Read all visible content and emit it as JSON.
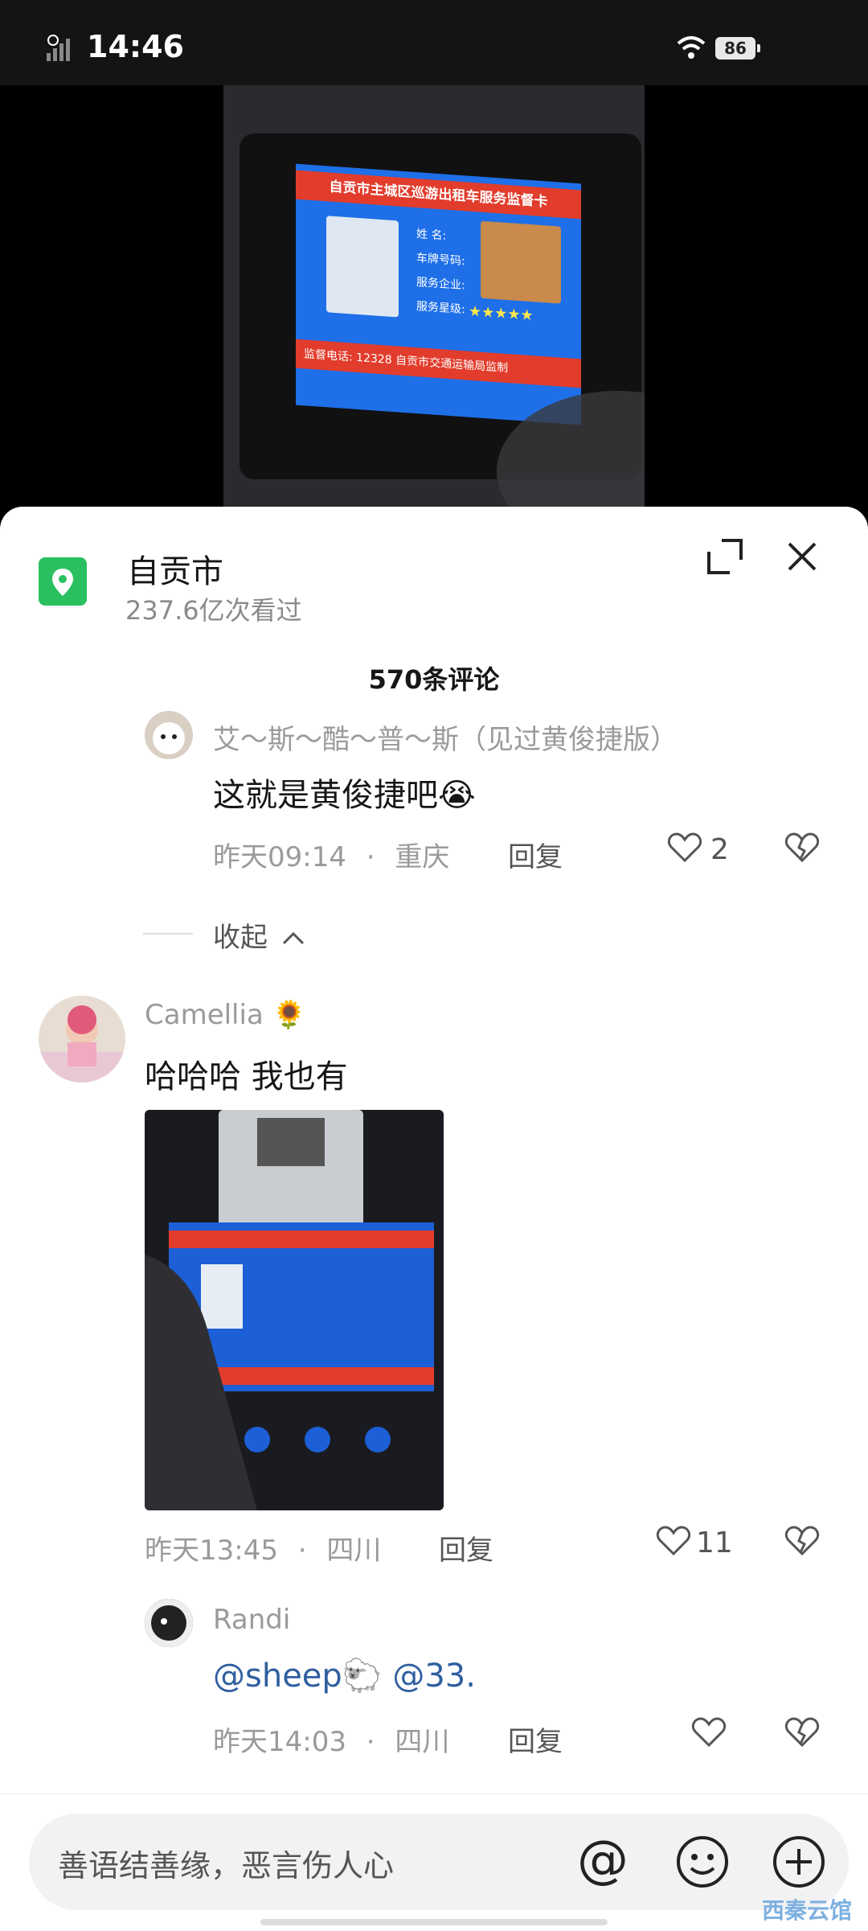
{
  "status_bar": {
    "time": "14:46",
    "battery": "86"
  },
  "video": {
    "screen_title": "自贡市主城区巡游出租车服务监督卡",
    "screen_fields": [
      "姓 名:",
      "车牌号码:",
      "服务企业:",
      "服务星级:"
    ],
    "screen_stars": "★★★★★",
    "screen_bottom": "监督电话: 12328   自贡市交通运输局监制"
  },
  "location": {
    "title": "自贡市",
    "views": "237.6亿次看过"
  },
  "comments_count": "570条评论",
  "comments": [
    {
      "name": "艾～斯～酷～普～斯（见过黄俊捷版）",
      "text": "这就是黄俊捷吧😭",
      "time": "昨天09:14",
      "place": "重庆",
      "reply": "回复",
      "likes": "2"
    },
    {
      "name": "Camellia 🌻",
      "text": "哈哈哈 我也有",
      "time": "昨天13:45",
      "place": "四川",
      "reply": "回复",
      "likes": "11"
    },
    {
      "name": "Randi",
      "text": "@sheep🐑 @33.",
      "time": "昨天14:03",
      "place": "四川",
      "reply": "回复",
      "likes": ""
    }
  ],
  "collapse_label": "收起",
  "input": {
    "placeholder": "善语结善缘，恶言伤人心",
    "at": "@"
  },
  "watermark": "西秦云馆",
  "icons": [
    "location-pin-icon",
    "expand-icon",
    "close-icon",
    "heart-icon",
    "broken-heart-icon",
    "chevron-up-icon",
    "emoji-icon",
    "plus-icon",
    "wifi-icon",
    "signal-icon"
  ]
}
